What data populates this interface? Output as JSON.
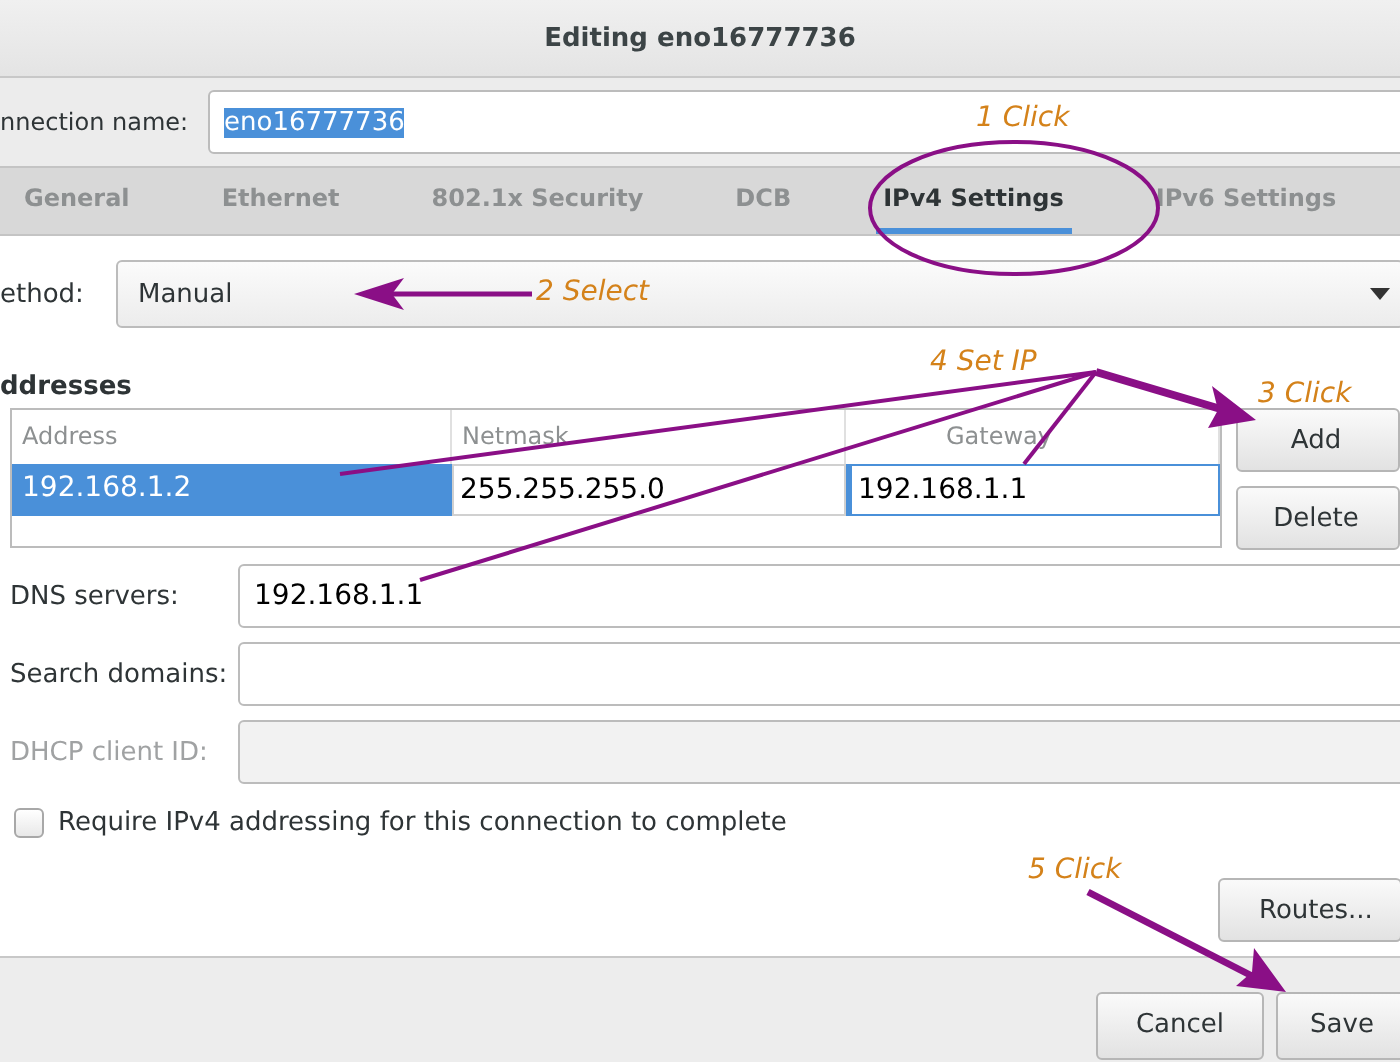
{
  "window": {
    "title": "Editing eno16777736"
  },
  "connection_name": {
    "label": "nnection name:",
    "value": "eno16777736",
    "selected": true
  },
  "tabs": [
    {
      "label": "General",
      "selected": false
    },
    {
      "label": "Ethernet",
      "selected": false
    },
    {
      "label": "802.1x Security",
      "selected": false
    },
    {
      "label": "DCB",
      "selected": false
    },
    {
      "label": "IPv4 Settings",
      "selected": true
    },
    {
      "label": "IPv6 Settings",
      "selected": false
    }
  ],
  "method": {
    "label": "ethod:",
    "value": "Manual"
  },
  "addresses": {
    "label": "ddresses",
    "columns": [
      "Address",
      "Netmask",
      "Gateway"
    ],
    "rows": [
      {
        "selected": true,
        "cells": [
          {
            "kind": "text",
            "value": "192.168.1.2"
          },
          {
            "kind": "entry",
            "value": "255.255.255.0"
          },
          {
            "kind": "entry",
            "value": "192.168.1.1"
          }
        ]
      }
    ],
    "buttons": [
      "Add",
      "Delete"
    ]
  },
  "fields": [
    {
      "label": "DNS servers:",
      "value": "192.168.1.1",
      "disabled": false
    },
    {
      "label": "Search domains:",
      "disabled": false
    },
    {
      "label": "DHCP client ID:",
      "disabled": true
    }
  ],
  "require_checkbox": {
    "label": "Require IPv4 addressing for this connection to complete",
    "checked": false
  },
  "routes_button": "Routes...",
  "footer_buttons": [
    "Cancel",
    "Save"
  ],
  "annotations": [
    {
      "text": "1 Click"
    },
    {
      "text": "2 Select"
    },
    {
      "text": "4 Set IP"
    },
    {
      "text": "3 Click"
    },
    {
      "text": "5 Click"
    }
  ]
}
